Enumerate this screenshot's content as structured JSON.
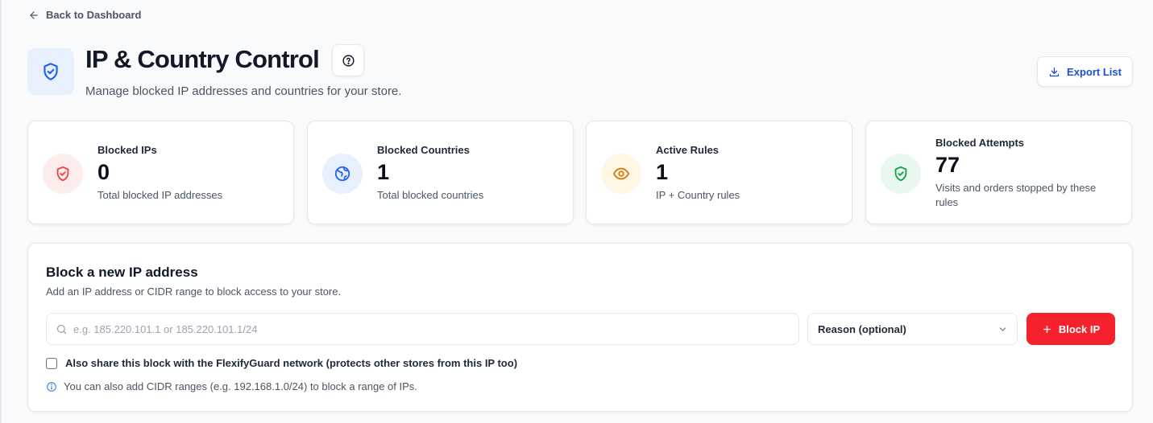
{
  "nav": {
    "back_label": "Back to Dashboard"
  },
  "header": {
    "title": "IP & Country Control",
    "subtitle": "Manage blocked IP addresses and countries for your store.",
    "export_label": "Export List"
  },
  "stats": [
    {
      "label": "Blocked IPs",
      "value": "0",
      "description": "Total blocked IP addresses",
      "icon": "shield-icon",
      "color": "#ef4444"
    },
    {
      "label": "Blocked Countries",
      "value": "1",
      "description": "Total blocked countries",
      "icon": "globe-icon",
      "color": "#2563eb"
    },
    {
      "label": "Active Rules",
      "value": "1",
      "description": "IP + Country rules",
      "icon": "eye-icon",
      "color": "#d97706"
    },
    {
      "label": "Blocked Attempts",
      "value": "77",
      "description": "Visits and orders stopped by these rules",
      "icon": "shield-check-icon",
      "color": "#16a34a"
    }
  ],
  "block_form": {
    "title": "Block a new IP address",
    "description": "Add an IP address or CIDR range to block access to your store.",
    "ip_placeholder": "e.g. 185.220.101.1 or 185.220.101.1/24",
    "ip_value": "",
    "reason_value": "Reason (optional)",
    "submit_label": "Block IP",
    "share_label": "Also share this block with the FlexifyGuard network (protects other stores from this IP too)",
    "share_checked": false,
    "info_text": "You can also add CIDR ranges (e.g. 192.168.1.0/24) to block a range of IPs."
  },
  "colors": {
    "accent": "#1d4ed8",
    "danger": "#f5222d",
    "background": "#f9fafb"
  }
}
